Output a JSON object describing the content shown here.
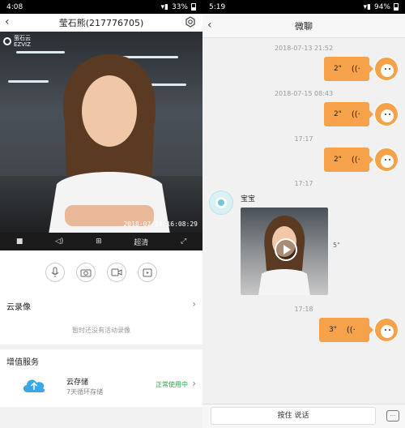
{
  "left": {
    "status": {
      "time": "4:08",
      "battery": "33%"
    },
    "title": "莹石熊(217776705)",
    "video": {
      "brand_cn": "萤石云",
      "brand_en": "EZVIZ",
      "timestamp": "2018-07-14 16:08:29"
    },
    "controls": {
      "quality": "超清"
    },
    "cloud_recording": {
      "title": "云录像",
      "empty_note": "暂时还没有活动录像"
    },
    "value_added": {
      "title": "增值服务",
      "service_name": "云存储",
      "service_sub": "7天循环存储",
      "service_status": "正常使用中"
    }
  },
  "right": {
    "status": {
      "time": "5:19",
      "battery": "94%"
    },
    "title": "微聊",
    "messages": [
      {
        "timestamp": "2018-07-13 21:52",
        "duration": "2\""
      },
      {
        "timestamp": "2018-07-15 08:43",
        "duration": "2\""
      },
      {
        "timestamp": "17:17",
        "duration": "2\""
      },
      {
        "timestamp": "17:17",
        "sender": "宝宝",
        "video_length": "5\""
      },
      {
        "timestamp": "17:18",
        "duration": "3\""
      }
    ],
    "hold_to_talk": "按住 说话"
  },
  "colors": {
    "bubble": "#f6a24a",
    "status_ok": "#2aa44a"
  },
  "icons": [
    "back-arrow-icon",
    "gear-icon",
    "stop-icon",
    "volume-icon",
    "grid-icon",
    "fullscreen-icon",
    "microphone-icon",
    "camera-icon",
    "video-icon",
    "playback-icon",
    "cloud-upload-icon",
    "voice-wave-icon",
    "play-icon",
    "keyboard-icon"
  ]
}
